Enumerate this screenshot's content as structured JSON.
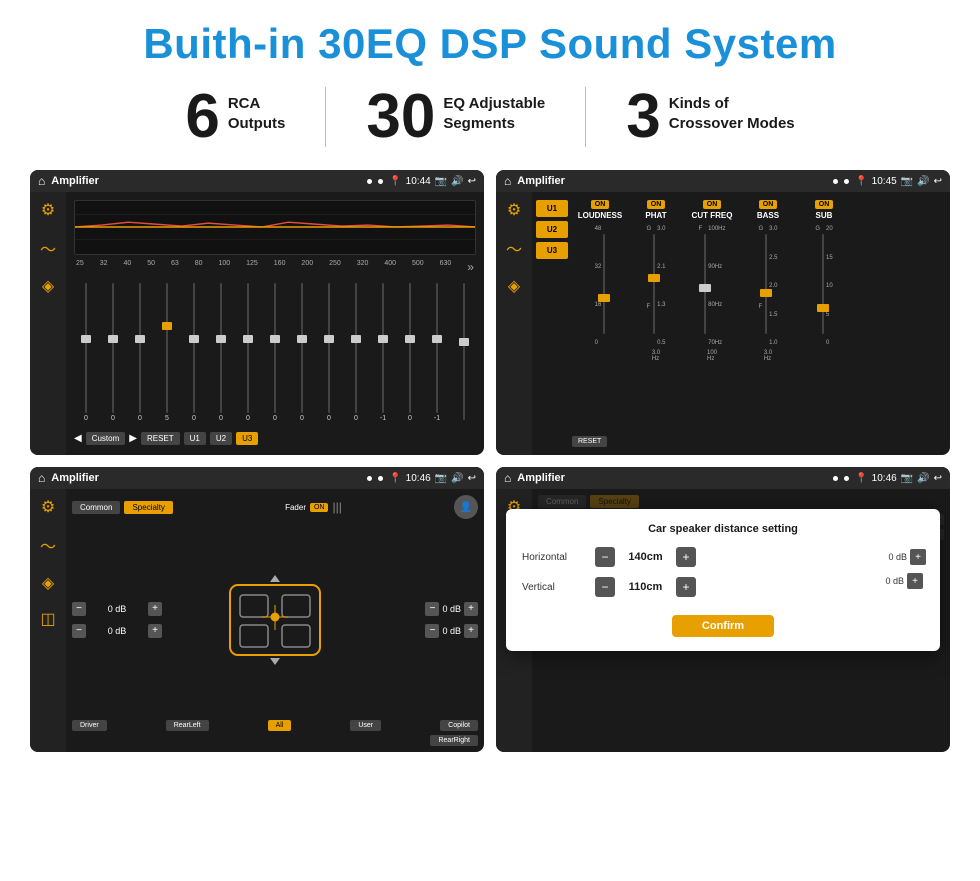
{
  "title": "Buith-in 30EQ DSP Sound System",
  "stats": [
    {
      "number": "6",
      "label_line1": "RCA",
      "label_line2": "Outputs"
    },
    {
      "number": "30",
      "label_line1": "EQ Adjustable",
      "label_line2": "Segments"
    },
    {
      "number": "3",
      "label_line1": "Kinds of",
      "label_line2": "Crossover Modes"
    }
  ],
  "screenshots": [
    {
      "id": "eq-screen",
      "status_bar": {
        "time": "10:44",
        "app": "Amplifier"
      },
      "eq": {
        "frequencies": [
          "25",
          "32",
          "40",
          "50",
          "63",
          "80",
          "100",
          "125",
          "160",
          "200",
          "250",
          "320",
          "400",
          "500",
          "630"
        ],
        "values": [
          "0",
          "0",
          "0",
          "5",
          "0",
          "0",
          "0",
          "0",
          "0",
          "0",
          "0",
          "-1",
          "0",
          "-1",
          ""
        ],
        "buttons": [
          "Custom",
          "RESET",
          "U1",
          "U2",
          "U3"
        ]
      }
    },
    {
      "id": "amp-screen",
      "status_bar": {
        "time": "10:45",
        "app": "Amplifier"
      },
      "presets": [
        "U1",
        "U2",
        "U3"
      ],
      "channels": [
        "LOUDNESS",
        "PHAT",
        "CUT FREQ",
        "BASS",
        "SUB"
      ],
      "reset_label": "RESET"
    },
    {
      "id": "speaker-screen",
      "status_bar": {
        "time": "10:46",
        "app": "Amplifier"
      },
      "tabs": [
        "Common",
        "Specialty"
      ],
      "fader": {
        "label": "Fader",
        "on": "ON"
      },
      "db_values": [
        "0 dB",
        "0 dB",
        "0 dB",
        "0 dB"
      ],
      "footer_btns": [
        "Driver",
        "RearLeft",
        "All",
        "User",
        "RearRight",
        "Copilot"
      ]
    },
    {
      "id": "distance-screen",
      "status_bar": {
        "time": "10:46",
        "app": "Amplifier"
      },
      "dialog": {
        "title": "Car speaker distance setting",
        "horizontal_label": "Horizontal",
        "horizontal_value": "140cm",
        "vertical_label": "Vertical",
        "vertical_value": "110cm",
        "confirm_btn": "Confirm"
      }
    }
  ],
  "colors": {
    "accent": "#1a90d9",
    "gold": "#e8a000",
    "dark_bg": "#1a1a1a",
    "text_dark": "#1a1a1a",
    "text_light": "#fff"
  }
}
